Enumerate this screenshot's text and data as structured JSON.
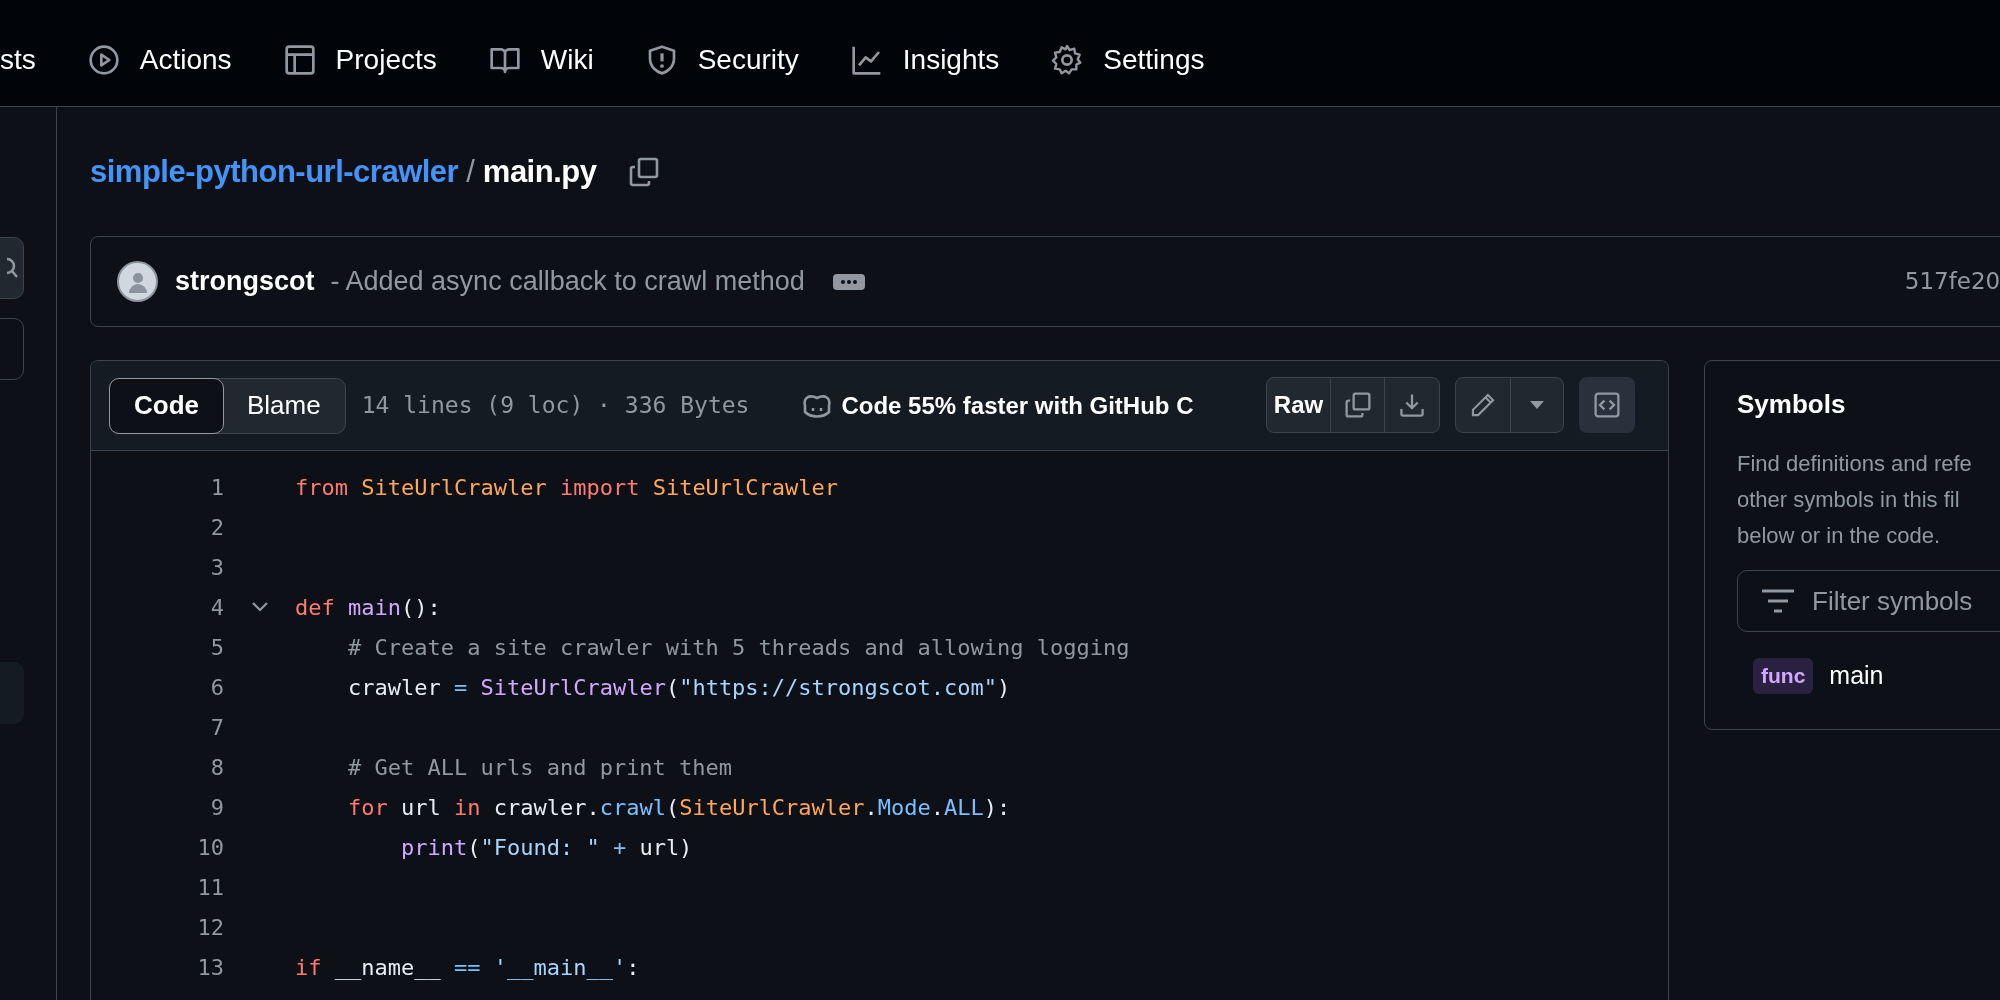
{
  "repo_nav": [
    {
      "label": "sts"
    },
    {
      "label": "Actions"
    },
    {
      "label": "Projects"
    },
    {
      "label": "Wiki"
    },
    {
      "label": "Security"
    },
    {
      "label": "Insights"
    },
    {
      "label": "Settings"
    }
  ],
  "breadcrumb": {
    "repo": "simple-python-url-crawler",
    "separator": "/",
    "file": "main.py"
  },
  "commit": {
    "author": "strongscot",
    "message": "- Added async callback to crawl method",
    "sha": "517fe20"
  },
  "file_view": {
    "tabs": [
      {
        "label": "Code",
        "selected": true
      },
      {
        "label": "Blame",
        "selected": false
      }
    ],
    "meta": "14 lines (9 loc) · 336 Bytes",
    "copilot_promo": "Code 55% faster with GitHub C",
    "raw_button": "Raw",
    "lines": [
      {
        "number": "1",
        "collapsible": false,
        "tokens": [
          {
            "kind": "keyword",
            "text": "from "
          },
          {
            "kind": "class",
            "text": "SiteUrlCrawler "
          },
          {
            "kind": "keyword",
            "text": "import "
          },
          {
            "kind": "class",
            "text": "SiteUrlCrawler"
          }
        ]
      },
      {
        "number": "2",
        "collapsible": false
      },
      {
        "number": "3",
        "collapsible": false
      },
      {
        "number": "4",
        "collapsible": true,
        "tokens": [
          {
            "kind": "keyword",
            "text": "def "
          },
          {
            "kind": "func",
            "text": "main"
          },
          {
            "kind": "plain",
            "text": "():"
          }
        ]
      },
      {
        "number": "5",
        "collapsible": false,
        "tokens": [
          {
            "kind": "comment",
            "text": "    # Create a site crawler with 5 threads and allowing logging"
          }
        ]
      },
      {
        "number": "6",
        "collapsible": false,
        "tokens": [
          {
            "kind": "plain",
            "text": "    crawler "
          },
          {
            "kind": "operator",
            "text": "= "
          },
          {
            "kind": "func",
            "text": "SiteUrlCrawler"
          },
          {
            "kind": "plain",
            "text": "("
          },
          {
            "kind": "string",
            "text": "\"https://strongscot.com\""
          },
          {
            "kind": "plain",
            "text": ")"
          }
        ]
      },
      {
        "number": "7",
        "collapsible": false
      },
      {
        "number": "8",
        "collapsible": false,
        "tokens": [
          {
            "kind": "comment",
            "text": "    # Get ALL urls and print them"
          }
        ]
      },
      {
        "number": "9",
        "collapsible": false,
        "tokens": [
          {
            "kind": "keyword",
            "text": "    for"
          },
          {
            "kind": "plain",
            "text": " url "
          },
          {
            "kind": "keyword",
            "text": "in"
          },
          {
            "kind": "plain",
            "text": " crawler."
          },
          {
            "kind": "operator",
            "text": "crawl"
          },
          {
            "kind": "plain",
            "text": "("
          },
          {
            "kind": "class",
            "text": "SiteUrlCrawler"
          },
          {
            "kind": "plain",
            "text": "."
          },
          {
            "kind": "operator",
            "text": "Mode"
          },
          {
            "kind": "plain",
            "text": "."
          },
          {
            "kind": "operator",
            "text": "ALL"
          },
          {
            "kind": "plain",
            "text": "):"
          }
        ]
      },
      {
        "number": "10",
        "collapsible": false,
        "tokens": [
          {
            "kind": "func",
            "text": "        print"
          },
          {
            "kind": "plain",
            "text": "("
          },
          {
            "kind": "string",
            "text": "\"Found: \" "
          },
          {
            "kind": "operator",
            "text": "+"
          },
          {
            "kind": "plain",
            "text": " url)"
          }
        ]
      },
      {
        "number": "11",
        "collapsible": false
      },
      {
        "number": "12",
        "collapsible": false
      },
      {
        "number": "13",
        "collapsible": false,
        "tokens": [
          {
            "kind": "keyword",
            "text": "if"
          },
          {
            "kind": "plain",
            "text": " __name__ "
          },
          {
            "kind": "operator",
            "text": "== "
          },
          {
            "kind": "string",
            "text": "'__main__'"
          },
          {
            "kind": "plain",
            "text": ":"
          }
        ]
      }
    ]
  },
  "symbols": {
    "title": "Symbols",
    "description_lines": [
      "Find definitions and refe",
      "other symbols in this fil",
      "below or in the code."
    ],
    "filter_placeholder": "Filter symbols",
    "items": [
      {
        "kind": "func",
        "name": "main"
      }
    ]
  }
}
